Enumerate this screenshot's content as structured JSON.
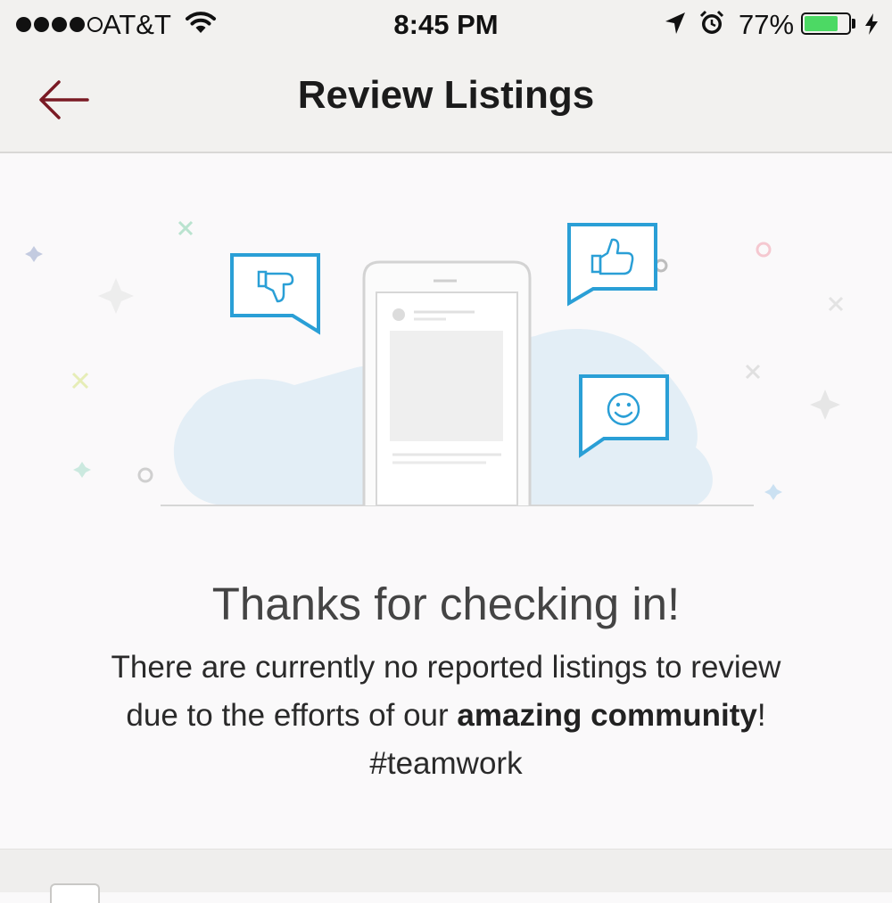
{
  "status_bar": {
    "carrier": "AT&T",
    "time": "8:45 PM",
    "battery_percent": "77%",
    "battery_level": 0.77,
    "signal_bars_filled": 4,
    "signal_bars_total": 5,
    "icons": [
      "wifi-icon",
      "location-arrow-icon",
      "alarm-icon",
      "battery-icon",
      "charging-bolt-icon"
    ]
  },
  "nav": {
    "title": "Review Listings",
    "back_icon": "arrow-left-icon",
    "accent_color": "#7a1a24"
  },
  "illustration": {
    "icons": [
      "thumbs-down-icon",
      "thumbs-up-icon",
      "smiley-icon",
      "phone-icon",
      "cloud-icon"
    ],
    "accent_color": "#2a9fd6"
  },
  "message": {
    "title": "Thanks for checking in!",
    "body_part1": "There are currently no reported listings to review due to the efforts of our ",
    "body_bold": "amazing community",
    "body_part2": "! #teamwork"
  }
}
